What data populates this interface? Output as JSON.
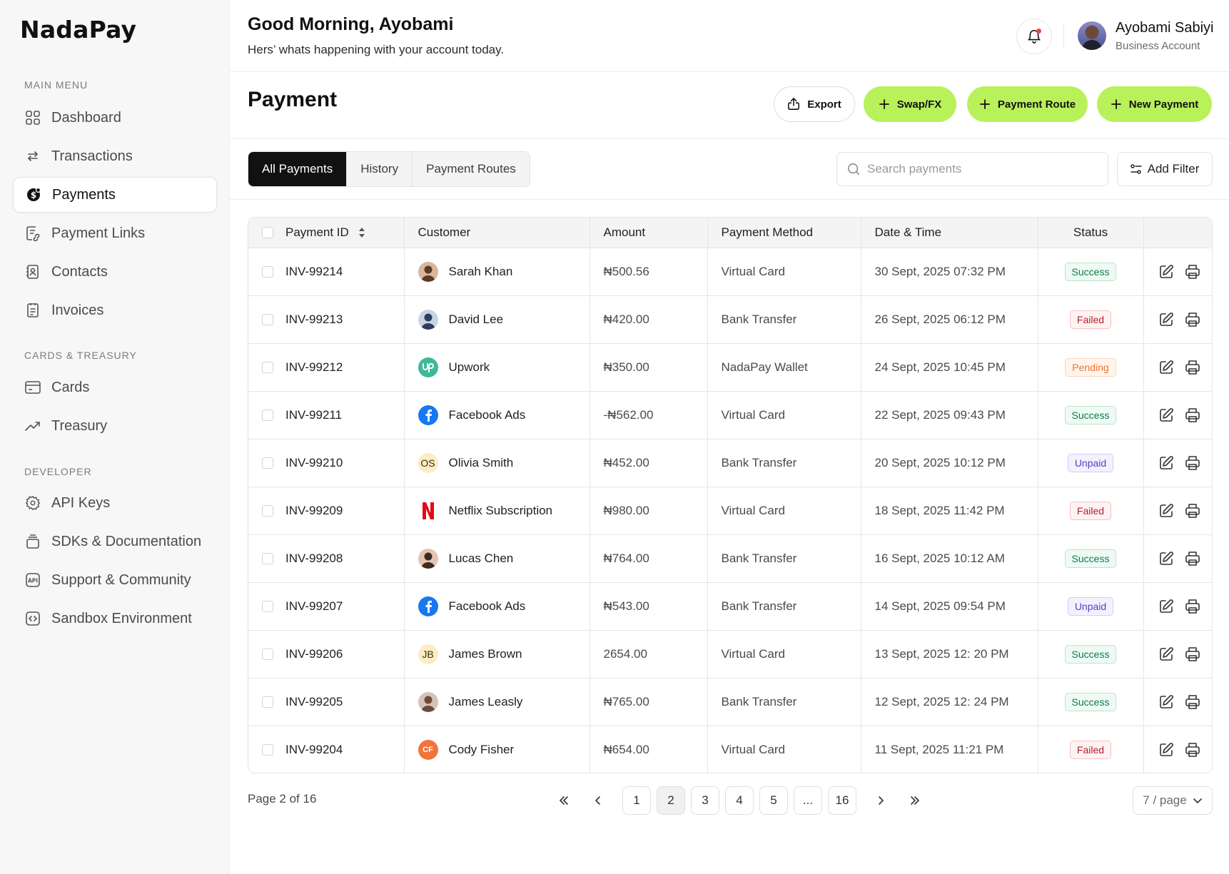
{
  "brand": "NadaPay",
  "sidebar": {
    "sections": [
      {
        "label": "MAIN MENU",
        "items": [
          {
            "label": "Dashboard",
            "icon": "grid-icon"
          },
          {
            "label": "Transactions",
            "icon": "arrows-icon"
          },
          {
            "label": "Payments",
            "icon": "payment-icon",
            "active": true
          },
          {
            "label": "Payment Links",
            "icon": "link-doc-icon"
          },
          {
            "label": "Contacts",
            "icon": "contacts-icon"
          },
          {
            "label": "Invoices",
            "icon": "invoice-icon"
          }
        ]
      },
      {
        "label": "CARDS & TREASURY",
        "items": [
          {
            "label": "Cards",
            "icon": "card-icon"
          },
          {
            "label": "Treasury",
            "icon": "trend-icon"
          }
        ]
      },
      {
        "label": "DEVELOPER",
        "items": [
          {
            "label": "API Keys",
            "icon": "gear-icon"
          },
          {
            "label": "SDKs & Documentation",
            "icon": "stack-icon"
          },
          {
            "label": "Support & Community",
            "icon": "api-icon"
          },
          {
            "label": "Sandbox Environment",
            "icon": "code-icon"
          }
        ]
      }
    ]
  },
  "header": {
    "greeting": "Good Morning, Ayobami",
    "subtitle": "Hers’ whats happening with your account today.",
    "user_name": "Ayobami Sabiyi",
    "user_role": "Business Account"
  },
  "page": {
    "title": "Payment",
    "buttons": {
      "export": "Export",
      "swap": "Swap/FX",
      "route": "Payment Route",
      "new": "New Payment"
    }
  },
  "tabs": [
    "All Payments",
    "History",
    "Payment Routes"
  ],
  "search": {
    "placeholder": "Search payments"
  },
  "filter_label": "Add Filter",
  "table": {
    "columns": [
      "Payment ID",
      "Customer",
      "Amount",
      "Payment Method",
      "Date & Time",
      "Status"
    ],
    "rows": [
      {
        "id": "INV-99214",
        "customer": "Sarah Khan",
        "avatar": "photo",
        "amount": "₦500.56",
        "method": "Virtual Card",
        "date": "30 Sept, 2025 07:32 PM",
        "status": "Success"
      },
      {
        "id": "INV-99213",
        "customer": "David Lee",
        "avatar": "photo",
        "amount": "₦420.00",
        "method": "Bank Transfer",
        "date": "26 Sept, 2025 06:12 PM",
        "status": "Failed"
      },
      {
        "id": "INV-99212",
        "customer": "Upwork",
        "avatar": "upwork",
        "amount": "₦350.00",
        "method": "NadaPay Wallet",
        "date": "24 Sept, 2025 10:45 PM",
        "status": "Pending"
      },
      {
        "id": "INV-99211",
        "customer": "Facebook Ads",
        "avatar": "facebook",
        "amount": "-₦562.00",
        "method": "Virtual Card",
        "date": "22 Sept, 2025 09:43 PM",
        "status": "Success"
      },
      {
        "id": "INV-99210",
        "customer": "Olivia Smith",
        "avatar": "OS",
        "amount": "₦452.00",
        "method": "Bank Transfer",
        "date": "20 Sept, 2025 10:12 PM",
        "status": "Unpaid"
      },
      {
        "id": "INV-99209",
        "customer": "Netflix Subscription",
        "avatar": "netflix",
        "amount": "₦980.00",
        "method": "Virtual Card",
        "date": "18 Sept, 2025 11:42 PM",
        "status": "Failed"
      },
      {
        "id": "INV-99208",
        "customer": "Lucas Chen",
        "avatar": "photo",
        "amount": "₦764.00",
        "method": "Bank Transfer",
        "date": "16 Sept, 2025 10:12 AM",
        "status": "Success"
      },
      {
        "id": "INV-99207",
        "customer": "Facebook Ads",
        "avatar": "facebook",
        "amount": "₦543.00",
        "method": "Bank Transfer",
        "date": "14 Sept, 2025 09:54 PM",
        "status": "Unpaid"
      },
      {
        "id": "INV-99206",
        "customer": "James Brown",
        "avatar": "JB",
        "amount": "2654.00",
        "method": "Virtual Card",
        "date": "13 Sept, 2025 12: 20 PM",
        "status": "Success"
      },
      {
        "id": "INV-99205",
        "customer": "James Leasly",
        "avatar": "photo",
        "amount": "₦765.00",
        "method": "Bank Transfer",
        "date": "12 Sept, 2025 12: 24 PM",
        "status": "Success"
      },
      {
        "id": "INV-99204",
        "customer": "Cody Fisher",
        "avatar": "CF",
        "amount": "₦654.00",
        "method": "Virtual Card",
        "date": "11 Sept, 2025 11:21 PM",
        "status": "Failed"
      }
    ]
  },
  "pagination": {
    "info": "Page 2 of 16",
    "pages": [
      "1",
      "2",
      "3",
      "4",
      "5",
      "...",
      "16"
    ],
    "current": "2",
    "per_page": "7 / page"
  },
  "colors": {
    "accent_green": "#b9f15a",
    "success": "#0f7a4a",
    "failed": "#b4232c",
    "pending": "#e8772e",
    "unpaid": "#5b3cc4"
  }
}
